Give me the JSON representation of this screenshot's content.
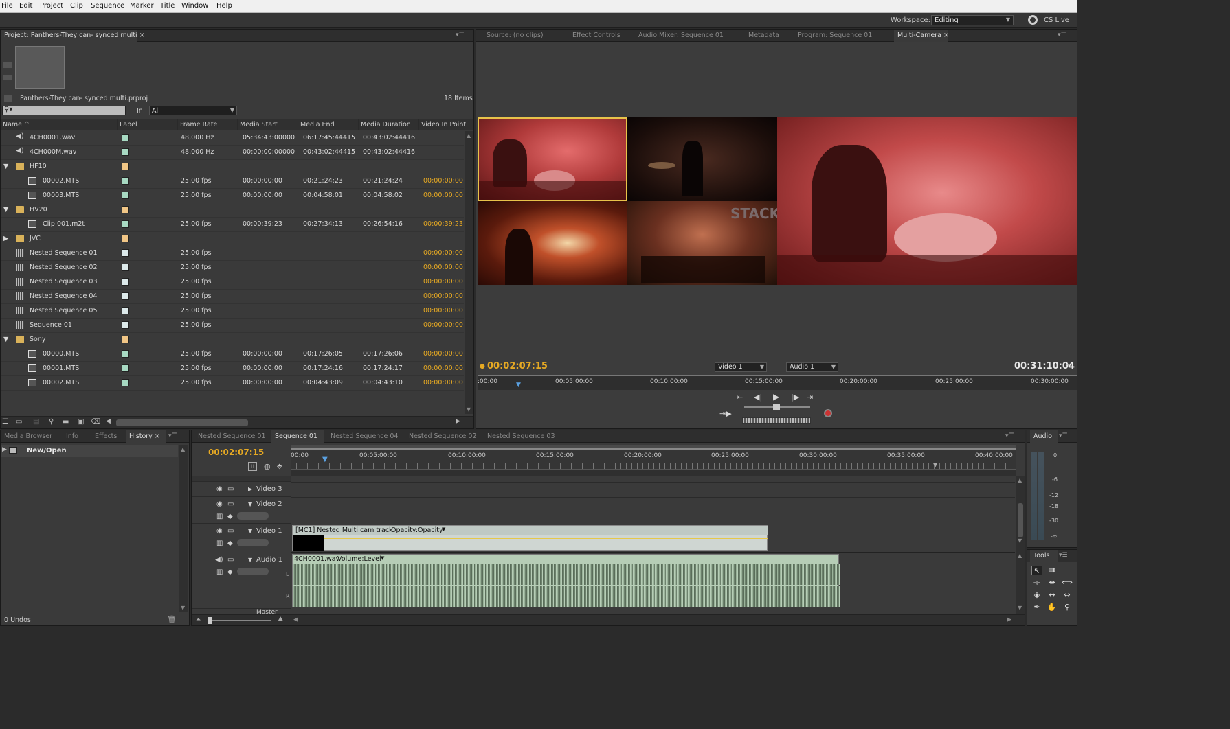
{
  "menu": [
    "File",
    "Edit",
    "Project",
    "Clip",
    "Sequence",
    "Marker",
    "Title",
    "Window",
    "Help"
  ],
  "workspace": {
    "label": "Workspace:",
    "value": "Editing",
    "cslive": "CS Live"
  },
  "project": {
    "tab": "Project: Panthers-They can- synced multi",
    "filename": "Panthers-They can- synced multi.prproj",
    "items_count": "18 Items",
    "in_label": "In:",
    "in_value": "All",
    "columns": [
      "Name",
      "Label",
      "Frame Rate",
      "Media Start",
      "Media End",
      "Media Duration",
      "Video In Point"
    ],
    "rows": [
      {
        "name": "4CH0001.wav",
        "label_color": "#a7d9c2",
        "rate": "48,000 Hz",
        "start": "05:34:43:00000",
        "end": "06:17:45:44415",
        "dur": "00:43:02:44416",
        "vin": "",
        "icon": "audio",
        "indent": 1
      },
      {
        "name": "4CH000M.wav",
        "label_color": "#a7d9c2",
        "rate": "48,000 Hz",
        "start": "00:00:00:00000",
        "end": "00:43:02:44415",
        "dur": "00:43:02:44416",
        "vin": "",
        "icon": "audio",
        "indent": 1
      },
      {
        "name": "HF10",
        "label_color": "#f1c686",
        "rate": "",
        "start": "",
        "end": "",
        "dur": "",
        "vin": "",
        "icon": "folder",
        "indent": 0,
        "open": true
      },
      {
        "name": "00002.MTS",
        "label_color": "#a7d9c2",
        "rate": "25.00 fps",
        "start": "00:00:00:00",
        "end": "00:21:24:23",
        "dur": "00:21:24:24",
        "vin": "00:00:00:00",
        "icon": "clip",
        "indent": 2
      },
      {
        "name": "00003.MTS",
        "label_color": "#a7d9c2",
        "rate": "25.00 fps",
        "start": "00:00:00:00",
        "end": "00:04:58:01",
        "dur": "00:04:58:02",
        "vin": "00:00:00:00",
        "icon": "clip",
        "indent": 2
      },
      {
        "name": "HV20",
        "label_color": "#f1c686",
        "rate": "",
        "start": "",
        "end": "",
        "dur": "",
        "vin": "",
        "icon": "folder",
        "indent": 0,
        "open": true
      },
      {
        "name": "Clip 001.m2t",
        "label_color": "#a7d9c2",
        "rate": "25.00 fps",
        "start": "00:00:39:23",
        "end": "00:27:34:13",
        "dur": "00:26:54:16",
        "vin": "00:00:39:23",
        "icon": "clip",
        "indent": 2
      },
      {
        "name": "JVC",
        "label_color": "#f1c686",
        "rate": "",
        "start": "",
        "end": "",
        "dur": "",
        "vin": "",
        "icon": "folder",
        "indent": 0,
        "open": false
      },
      {
        "name": "Nested Sequence 01",
        "label_color": "#dce9ea",
        "rate": "25.00 fps",
        "start": "",
        "end": "",
        "dur": "",
        "vin": "00:00:00:00",
        "icon": "seq",
        "indent": 1
      },
      {
        "name": "Nested Sequence 02",
        "label_color": "#dce9ea",
        "rate": "25.00 fps",
        "start": "",
        "end": "",
        "dur": "",
        "vin": "00:00:00:00",
        "icon": "seq",
        "indent": 1
      },
      {
        "name": "Nested Sequence 03",
        "label_color": "#dce9ea",
        "rate": "25.00 fps",
        "start": "",
        "end": "",
        "dur": "",
        "vin": "00:00:00:00",
        "icon": "seq",
        "indent": 1
      },
      {
        "name": "Nested Sequence 04",
        "label_color": "#dce9ea",
        "rate": "25.00 fps",
        "start": "",
        "end": "",
        "dur": "",
        "vin": "00:00:00:00",
        "icon": "seq",
        "indent": 1
      },
      {
        "name": "Nested Sequence 05",
        "label_color": "#dce9ea",
        "rate": "25.00 fps",
        "start": "",
        "end": "",
        "dur": "",
        "vin": "00:00:00:00",
        "icon": "seq",
        "indent": 1
      },
      {
        "name": "Sequence 01",
        "label_color": "#dce9ea",
        "rate": "25.00 fps",
        "start": "",
        "end": "",
        "dur": "",
        "vin": "00:00:00:00",
        "icon": "seq",
        "indent": 1
      },
      {
        "name": "Sony",
        "label_color": "#f1c686",
        "rate": "",
        "start": "",
        "end": "",
        "dur": "",
        "vin": "",
        "icon": "folder",
        "indent": 0,
        "open": true
      },
      {
        "name": "00000.MTS",
        "label_color": "#a7d9c2",
        "rate": "25.00 fps",
        "start": "00:00:00:00",
        "end": "00:17:26:05",
        "dur": "00:17:26:06",
        "vin": "00:00:00:00",
        "icon": "clip",
        "indent": 2
      },
      {
        "name": "00001.MTS",
        "label_color": "#a7d9c2",
        "rate": "25.00 fps",
        "start": "00:00:00:00",
        "end": "00:17:24:16",
        "dur": "00:17:24:17",
        "vin": "00:00:00:00",
        "icon": "clip",
        "indent": 2
      },
      {
        "name": "00002.MTS",
        "label_color": "#a7d9c2",
        "rate": "25.00 fps",
        "start": "00:00:00:00",
        "end": "00:04:43:09",
        "dur": "00:04:43:10",
        "vin": "00:00:00:00",
        "icon": "clip",
        "indent": 2
      }
    ]
  },
  "monitor": {
    "tabs": [
      "Source: (no clips)",
      "Effect Controls",
      "Audio Mixer: Sequence 01",
      "Metadata",
      "Program: Sequence 01",
      "Multi-Camera"
    ],
    "timecode": "00:02:07:15",
    "duration": "00:31:10:04",
    "video_select": "Video 1",
    "audio_select": "Audio 1",
    "ruler": [
      ":00:00",
      "00:05:00:00",
      "00:10:00:00",
      "00:15:00:00",
      "00:20:00:00",
      "00:25:00:00",
      "00:30:00:00"
    ]
  },
  "history": {
    "tabs": [
      "Media Browser",
      "Info",
      "Effects",
      "History"
    ],
    "items": [
      "New/Open"
    ],
    "undos": "0 Undos"
  },
  "timeline": {
    "tabs": [
      "Nested Sequence 01",
      "Sequence 01",
      "Nested Sequence 04",
      "Nested Sequence 02",
      "Nested Sequence 03"
    ],
    "timecode": "00:02:07:15",
    "ruler": [
      "00:00",
      "00:05:00:00",
      "00:10:00:00",
      "00:15:00:00",
      "00:20:00:00",
      "00:25:00:00",
      "00:30:00:00",
      "00:35:00:00",
      "00:40:00:00"
    ],
    "tracks": {
      "v3": "Video 3",
      "v2": "Video 2",
      "v1": "Video 1",
      "a1": "Audio 1",
      "master": "Master"
    },
    "video_clip": {
      "name": "[MC1] Nested Multi cam track",
      "fx": "Opacity:Opacity"
    },
    "audio_clip": {
      "name": "4CH0001.wav",
      "fx": "Volume:Level"
    },
    "channels": [
      "L",
      "R"
    ]
  },
  "audio_meter": {
    "title": "Audio",
    "scale": [
      "0",
      "-6",
      "-12",
      "-18",
      "-30",
      "-∞"
    ]
  },
  "tools": {
    "title": "Tools"
  }
}
